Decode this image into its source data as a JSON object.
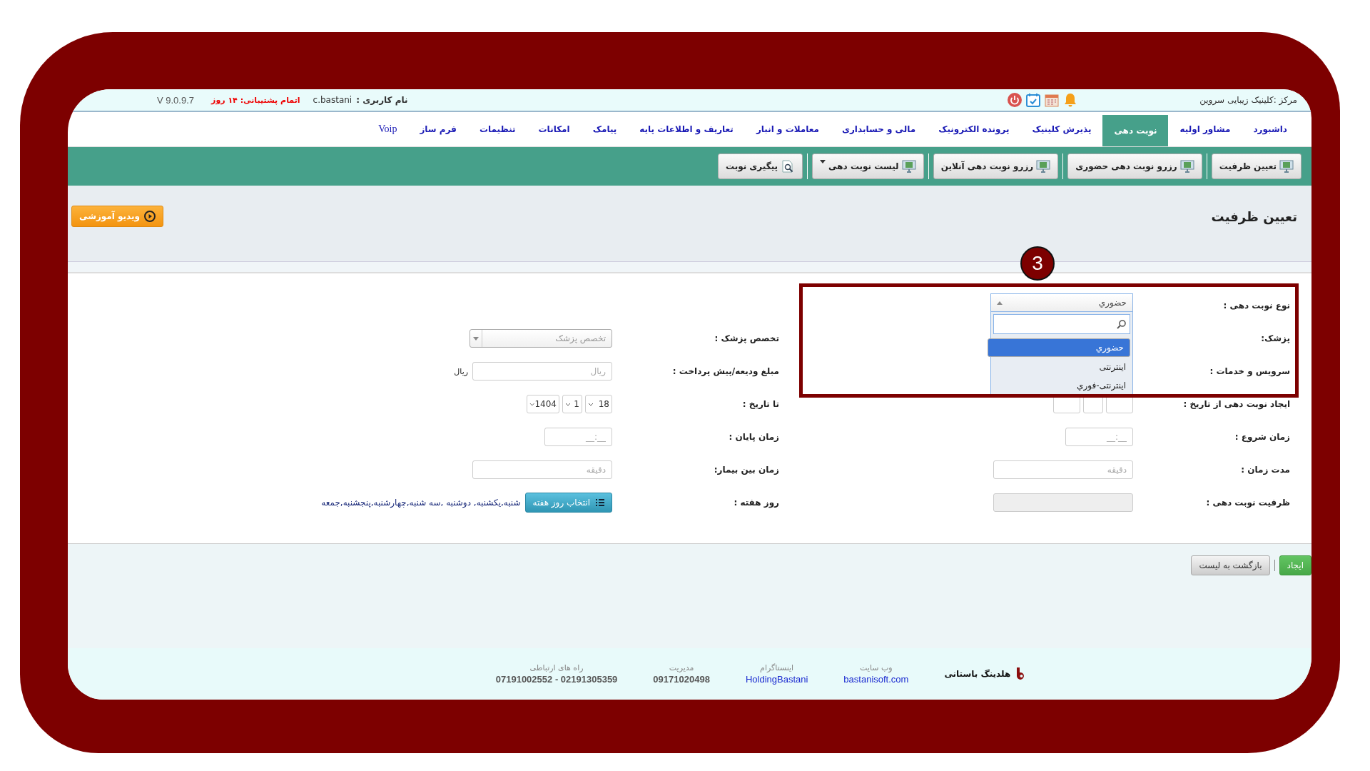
{
  "top_bar": {
    "clinic": "مرکز :کلینیک زیبایی سروین",
    "username_label": "نام کاربری :",
    "username": "c.bastani",
    "support": "اتمام پشتیبانی: ۱۴ روز",
    "version": "V 9.0.9.7"
  },
  "nav_tabs": [
    {
      "label": "داشبورد",
      "selected": false
    },
    {
      "label": "مشاور اولیه",
      "selected": false
    },
    {
      "label": "نوبت دهی",
      "selected": true
    },
    {
      "label": "پذیرش کلینیک",
      "selected": false
    },
    {
      "label": "پرونده الکترونیک",
      "selected": false
    },
    {
      "label": "مالی و حسابداری",
      "selected": false
    },
    {
      "label": "معاملات و انبار",
      "selected": false
    },
    {
      "label": "تعاریف و اطلاعات پایه",
      "selected": false
    },
    {
      "label": "پیامک",
      "selected": false
    },
    {
      "label": "امکانات",
      "selected": false
    },
    {
      "label": "تنظیمات",
      "selected": false
    },
    {
      "label": "فرم ساز",
      "selected": false
    },
    {
      "label": "Voip",
      "selected": false
    }
  ],
  "toolbar": [
    {
      "label": "تعیین ظرفیت",
      "kind": "page"
    },
    {
      "label": "رزرو نوبت دهی حضوری",
      "kind": "page"
    },
    {
      "label": "رزرو نوبت دهی آنلاین",
      "kind": "page"
    },
    {
      "label": "لیست نوبت دهی",
      "kind": "menu"
    },
    {
      "label": "پیگیری نوبت",
      "kind": "search"
    }
  ],
  "page": {
    "title": "تعیین ظرفیت",
    "video_button": "ویدیو آموزشی",
    "step": "3"
  },
  "form_right": [
    {
      "label": "نوع نوبت دهی :",
      "kind": "combo",
      "value": "حضوري",
      "expanded": true,
      "options": [
        {
          "label": "حضوري",
          "selected": true
        },
        {
          "label": "اینترنتی",
          "selected": false
        },
        {
          "label": "اینترنتی-فوري",
          "selected": false
        }
      ]
    },
    {
      "label": "پزشک:",
      "kind": "covered"
    },
    {
      "label": "سرویس و خدمات :",
      "kind": "covered"
    },
    {
      "label": "ایجاد نوبت دهی از تاریخ :",
      "kind": "covered-date"
    },
    {
      "label": "زمان شروع :",
      "kind": "time",
      "placeholder": "__:__"
    },
    {
      "label": "مدت زمان :",
      "kind": "number",
      "placeholder": "دقیقه"
    },
    {
      "label": "ظرفیت نوبت دهی :",
      "kind": "disabled"
    }
  ],
  "form_left": [
    {
      "kind": "empty"
    },
    {
      "label": "تخصص پزشک :",
      "kind": "select",
      "placeholder": "تخصص پزشک"
    },
    {
      "label": "مبلغ ودیعه/پیش پرداخت :",
      "kind": "money",
      "placeholder": "ریال",
      "unit": "ریال"
    },
    {
      "label": "تا تاریخ :",
      "kind": "date",
      "parts": [
        "18",
        "1",
        "1404"
      ]
    },
    {
      "label": "زمان پایان :",
      "kind": "time",
      "placeholder": "__:__"
    },
    {
      "label": "زمان بین بیمار:",
      "kind": "number",
      "placeholder": "دقیقه"
    },
    {
      "label": "روز هفته :",
      "kind": "weekdays",
      "button": "انتخاب روز هفته",
      "value": "شنبه,یکشنبه, دوشنبه ,سه شنبه,چهارشنبه,پنجشنبه,جمعه"
    }
  ],
  "actions": [
    {
      "label": "ایجاد",
      "kind": "primary"
    },
    {
      "label": "بازگشت به لیست",
      "kind": "secondary"
    }
  ],
  "footer": {
    "brand": "هلدینگ باستانی",
    "columns": [
      {
        "title": "وب سایت",
        "value": "bastanisoft.com",
        "link": true
      },
      {
        "title": "اینستاگرام",
        "value": "HoldingBastani",
        "link": true
      },
      {
        "title": "مدیریت",
        "value": "09171020498",
        "link": false
      },
      {
        "title": "راه های ارتباطی",
        "value": "07191002552 - 02191305359",
        "link": false
      }
    ]
  }
}
